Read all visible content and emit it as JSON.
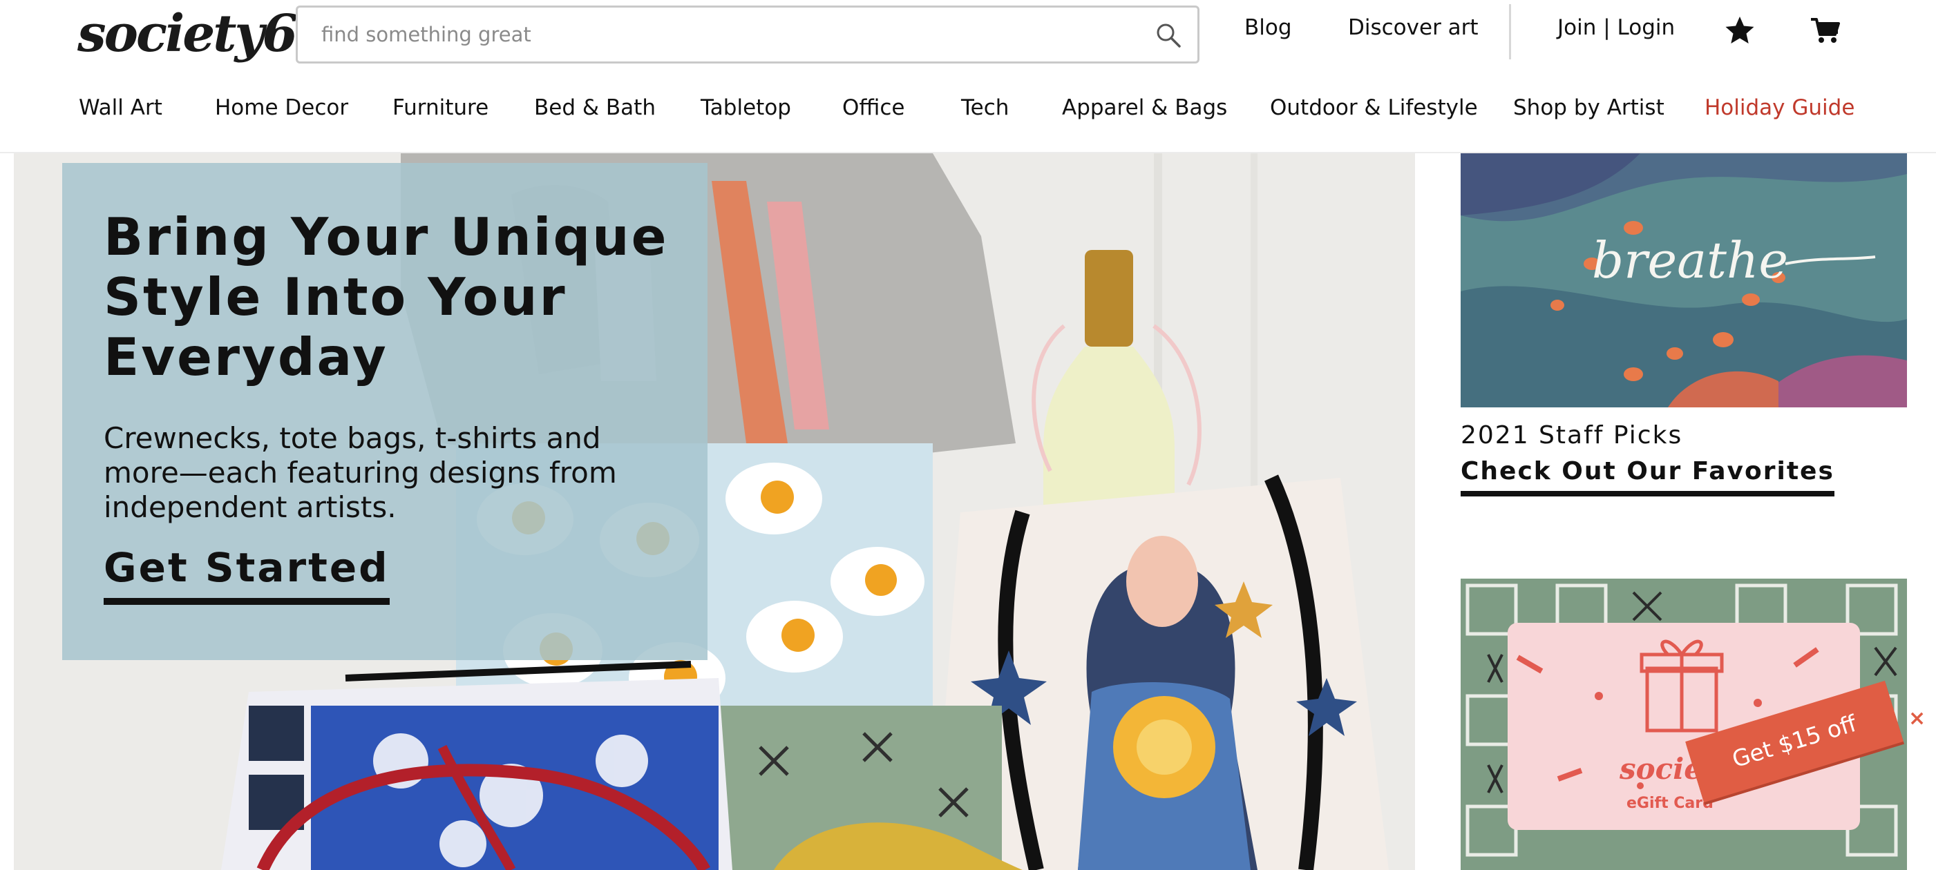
{
  "brand": {
    "logo_text": "society6"
  },
  "search": {
    "placeholder": "find something great",
    "icon": "magnifier"
  },
  "header_links": {
    "blog": "Blog",
    "discover": "Discover art",
    "account": "Join | Login"
  },
  "header_icons": {
    "wishlist": "star",
    "cart": "shopping-cart"
  },
  "nav": {
    "items": [
      {
        "label": "Wall Art"
      },
      {
        "label": "Home Decor"
      },
      {
        "label": "Furniture"
      },
      {
        "label": "Bed & Bath"
      },
      {
        "label": "Tabletop"
      },
      {
        "label": "Office"
      },
      {
        "label": "Tech"
      },
      {
        "label": "Apparel & Bags"
      },
      {
        "label": "Outdoor & Lifestyle"
      },
      {
        "label": "Shop by Artist"
      },
      {
        "label": "Holiday Guide"
      }
    ],
    "highlight_color": "#c0392b"
  },
  "hero": {
    "title": "Bring Your Unique Style Into Your Everyday",
    "subtitle": "Crewnecks, tote bags, t-shirts and more—each featuring designs from independent artists.",
    "cta": "Get Started",
    "panel_color": "#a6c5ce"
  },
  "staff_picks": {
    "image_text": "breathe",
    "kicker": "2021 Staff Picks",
    "cta": "Check Out Our Favorites"
  },
  "gift_card": {
    "brand_text": "society6",
    "label": "eGift Card"
  },
  "promo_ribbon": {
    "label": "Get $15 off",
    "close": "×",
    "color": "#e05d44"
  }
}
